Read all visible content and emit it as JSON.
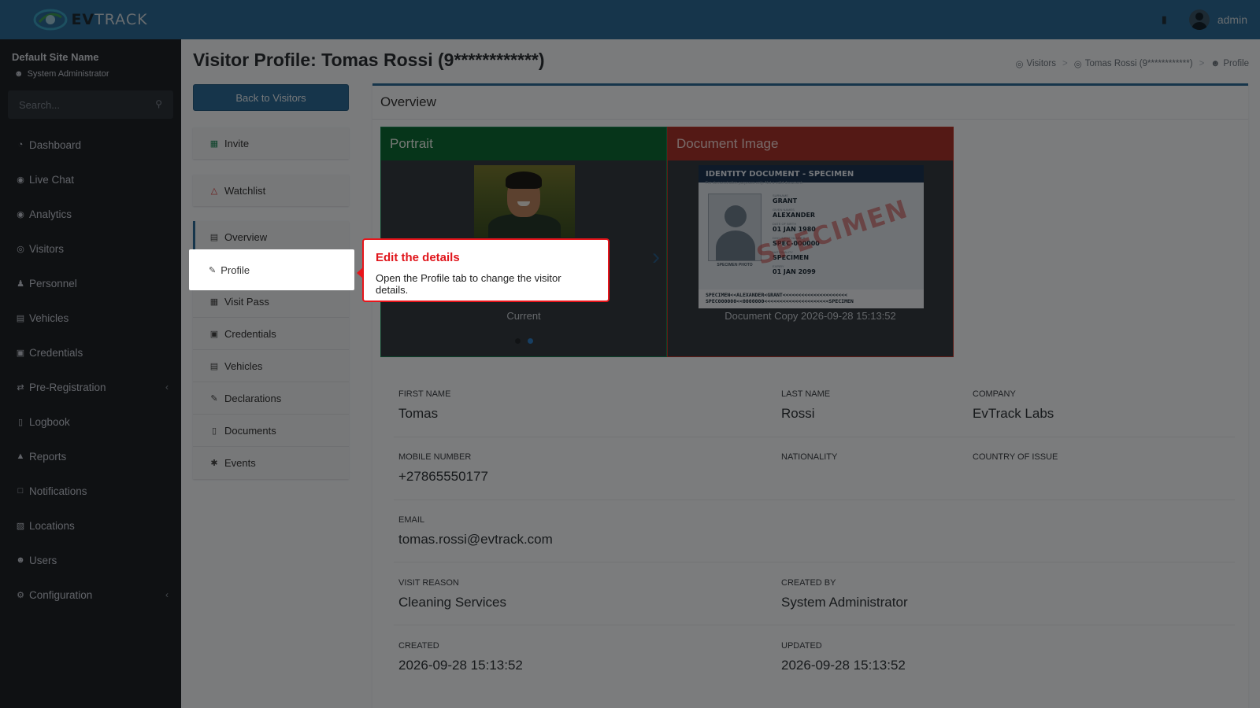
{
  "app": {
    "brand_prefix": "EV",
    "brand_suffix": "TRACK",
    "user": "admin"
  },
  "sidebar": {
    "site_name": "Default Site Name",
    "role": "System Administrator",
    "search_placeholder": "Search...",
    "items": [
      {
        "label": "Dashboard",
        "icon": "dashboard-icon"
      },
      {
        "label": "Live Chat",
        "icon": "headset-icon"
      },
      {
        "label": "Analytics",
        "icon": "analytics-icon"
      },
      {
        "label": "Visitors",
        "icon": "eye-icon"
      },
      {
        "label": "Personnel",
        "icon": "user-plus-icon"
      },
      {
        "label": "Vehicles",
        "icon": "car-icon"
      },
      {
        "label": "Credentials",
        "icon": "id-card-icon"
      },
      {
        "label": "Pre-Registration",
        "icon": "exchange-icon",
        "expandable": true
      },
      {
        "label": "Logbook",
        "icon": "book-icon"
      },
      {
        "label": "Reports",
        "icon": "chart-icon"
      },
      {
        "label": "Notifications",
        "icon": "comment-icon"
      },
      {
        "label": "Locations",
        "icon": "building-icon"
      },
      {
        "label": "Users",
        "icon": "users-cog-icon"
      },
      {
        "label": "Configuration",
        "icon": "gear-icon",
        "expandable": true
      }
    ]
  },
  "page": {
    "title": "Visitor Profile: Tomas Rossi (9************)",
    "breadcrumb": [
      "Visitors",
      "Tomas Rossi (9************)",
      "Profile"
    ],
    "back_button": "Back to Visitors",
    "invite": "Invite",
    "watchlist": "Watchlist",
    "menu": [
      "Overview",
      "Profile",
      "Visit Pass",
      "Credentials",
      "Vehicles",
      "Declarations",
      "Documents",
      "Events"
    ],
    "active_menu": "Overview"
  },
  "overview": {
    "title": "Overview",
    "portrait_title": "Portrait",
    "portrait_caption": "Current",
    "document_title": "Document Image",
    "document_caption": "Document Copy 2026-09-28 15:13:52"
  },
  "id_document": {
    "header": "IDENTITY DOCUMENT - SPECIMEN",
    "subheader": "For demonstration purposes only. Not a valid document.",
    "photo_caption": "SPECIMEN PHOTO",
    "stamp": "SPECIMEN",
    "fields": [
      {
        "label": "SURNAME",
        "value": "GRANT"
      },
      {
        "label": "GIVEN NAMES",
        "value": "ALEXANDER"
      },
      {
        "label": "DATE OF BIRTH",
        "value": "01 JAN 1980"
      },
      {
        "label": "DOCUMENT NUMBER",
        "value": "SPEC-000000"
      },
      {
        "label": "NATIONALITY",
        "value": "SPECIMEN"
      },
      {
        "label": "EXPIRY",
        "value": "01 JAN 2099"
      }
    ],
    "mrz_line1": "SPECIMEN<<ALEXANDER<GRANT<<<<<<<<<<<<<<<<<<<<<",
    "mrz_line2": "SPEC000000<<0000000<<<<<<<<<<<<<<<<<<<<<SPECIMEN"
  },
  "details": {
    "first_name": {
      "label": "FIRST NAME",
      "value": "Tomas"
    },
    "last_name": {
      "label": "LAST NAME",
      "value": "Rossi"
    },
    "company": {
      "label": "COMPANY",
      "value": "EvTrack Labs"
    },
    "mobile": {
      "label": "MOBILE NUMBER",
      "value": "+27865550177"
    },
    "nationality": {
      "label": "NATIONALITY",
      "value": ""
    },
    "country_of_issue": {
      "label": "COUNTRY OF ISSUE",
      "value": ""
    },
    "email": {
      "label": "EMAIL",
      "value": "tomas.rossi@evtrack.com"
    },
    "visit_reason": {
      "label": "VISIT REASON",
      "value": "Cleaning Services"
    },
    "created_by": {
      "label": "CREATED BY",
      "value": "System Administrator"
    },
    "created": {
      "label": "CREATED",
      "value": "2026-09-28 15:13:52"
    },
    "updated": {
      "label": "UPDATED",
      "value": "2026-09-28 15:13:52"
    }
  },
  "tooltip": {
    "title": "Edit the details",
    "body": "Open the Profile tab to change the visitor details."
  },
  "colors": {
    "primary": "#2c6a96",
    "sidebar": "#1e2227",
    "portrait_header": "#0c6b34",
    "document_header": "#a8332b",
    "tooltip_accent": "#e8151b"
  }
}
